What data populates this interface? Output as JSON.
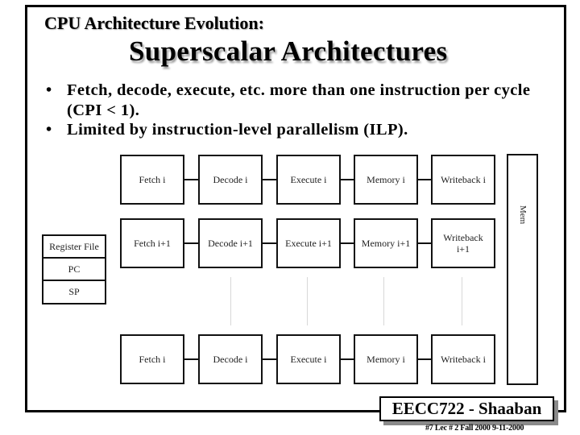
{
  "slide": {
    "subtitle": "CPU Architecture Evolution:",
    "title": "Superscalar Architectures",
    "bullets": [
      {
        "marker": "•",
        "text": "Fetch, decode, execute, etc. more than one instruction per cycle (CPI < 1)."
      },
      {
        "marker": "•",
        "text": "Limited by instruction-level parallelism (ILP)."
      }
    ]
  },
  "diagram": {
    "rows": [
      {
        "stages": [
          "Fetch i",
          "Decode i",
          "Execute i",
          "Memory i",
          "Writeback i"
        ]
      },
      {
        "stages": [
          "Fetch i+1",
          "Decode i+1",
          "Execute i+1",
          "Memory i+1",
          "Writeback i+1"
        ]
      },
      {
        "stages": [
          "Fetch i",
          "Decode i",
          "Execute i",
          "Memory i",
          "Writeback i"
        ]
      }
    ],
    "memory_bar_label": "Mem",
    "register_file": [
      "Register File",
      "PC",
      "SP"
    ]
  },
  "footer": {
    "course": "EECC722 - Shaaban",
    "meta": "#7   Lec # 2   Fall 2000 9-11-2000"
  }
}
